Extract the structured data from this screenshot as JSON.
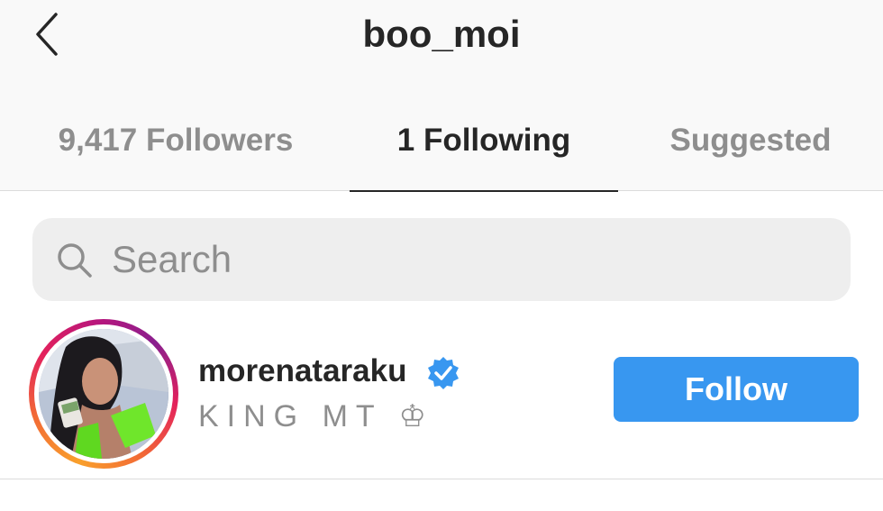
{
  "header": {
    "title": "boo_moi"
  },
  "tabs": [
    {
      "label": "9,417 Followers"
    },
    {
      "label": "1 Following"
    },
    {
      "label": "Suggested"
    }
  ],
  "search": {
    "placeholder": "Search",
    "value": ""
  },
  "list": [
    {
      "username": "morenataraku",
      "full_name": "KING MT ♔",
      "verified": true,
      "button_label": "Follow"
    }
  ],
  "colors": {
    "accent": "#3897f0",
    "verified": "#3897f0",
    "text": "#262626",
    "muted": "#8e8e8e"
  },
  "icons": {
    "back": "chevron-left-icon",
    "search": "search-icon",
    "verified": "verified-badge-icon"
  }
}
